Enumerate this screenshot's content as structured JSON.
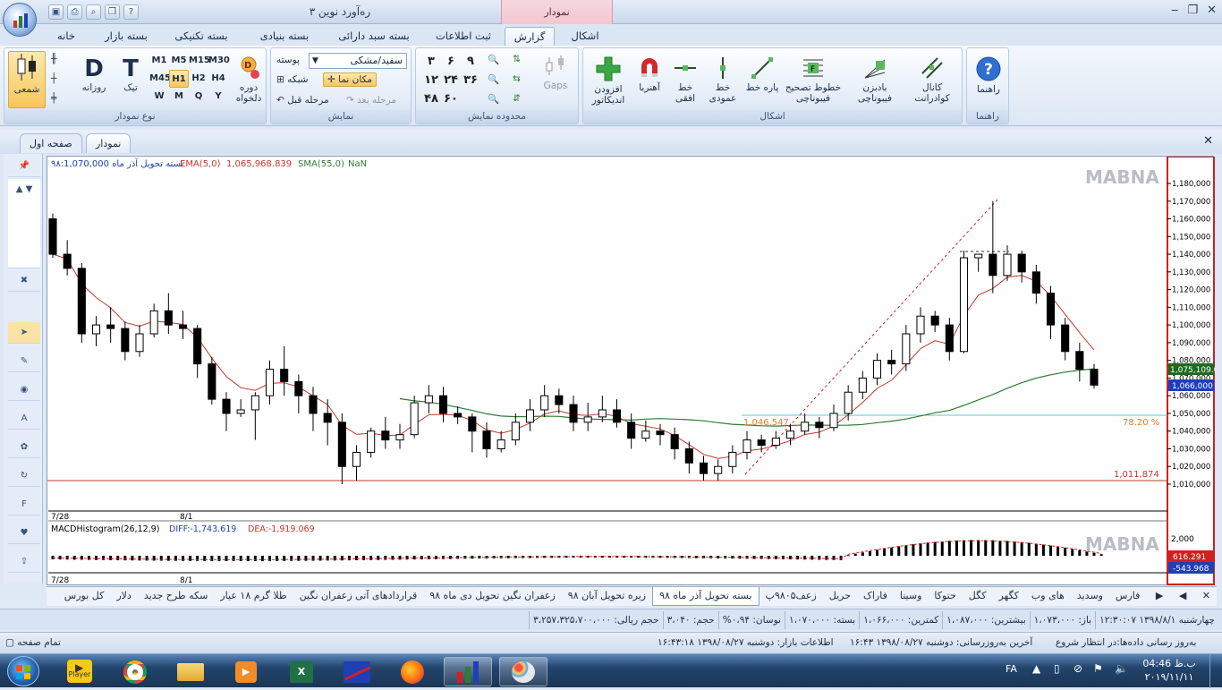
{
  "window": {
    "title": "ره‌آورد نوین ۳",
    "context_tab": "نمودار",
    "controls": [
      "minimize",
      "restore",
      "close"
    ]
  },
  "ribbon_tabs": [
    {
      "label": "خانه"
    },
    {
      "label": "بسته بازار"
    },
    {
      "label": "بسته تکنیکی"
    },
    {
      "label": "بسته بنیادی"
    },
    {
      "label": "بسته سبد دارائی"
    },
    {
      "label": "ثبت اطلاعات"
    },
    {
      "label": "گزارش",
      "active": true
    },
    {
      "label": "اشکال"
    }
  ],
  "ribbon": {
    "chart_type": {
      "label": "نوع نمودار",
      "candle": "شمعی",
      "daily": "روزانه",
      "tick": "تیک",
      "custom_period": "دوره دلخواه",
      "periods": [
        "M1",
        "M5",
        "M15",
        "M30",
        "M45",
        "H1",
        "H2",
        "H4",
        "W",
        "M",
        "Q",
        "Y"
      ],
      "d_letter": "D",
      "t_letter": "T"
    },
    "display": {
      "label": "نمایش",
      "bg_label": "پوسته",
      "bg_value": "سفید/مشکی",
      "grid": "شبکه",
      "cursor": "مکان نما",
      "undo": "مرحله قبل",
      "redo": "مرحله بعد"
    },
    "range": {
      "label": "محدوده نمایش",
      "nums": [
        "۳",
        "۶",
        "۹",
        "۱۲",
        "۲۴",
        "۳۶",
        "۴۸",
        "۶۰"
      ],
      "gaps": "Gaps"
    },
    "shapes": {
      "label": "اشکال",
      "items": [
        "کانال\nکوادرانت",
        "بادبزن\nفیبوناچی",
        "خطوط تصحیح\nفیبوناچی",
        "پاره خط",
        "خط\nعمودی",
        "خط\nافقی",
        "آهنربا",
        "افزودن\nاندیکاتور"
      ]
    },
    "help": {
      "label": "راهنما",
      "item": "راهنما"
    }
  },
  "doc_tabs": [
    {
      "label": "نمودار",
      "active": true
    },
    {
      "label": "صفحه اول"
    }
  ],
  "chart": {
    "header_name": "بسته تحویل آذر ماه ۹۸:1,070,000",
    "ema_label": "EMA(5,0)",
    "ema_value": "1,065,968.839",
    "sma_label": "SMA(55,0)",
    "sma_value": "NaN",
    "watermark": "MABNA",
    "price_ticks": [
      "1,180,000",
      "1,170,000",
      "1,160,000",
      "1,150,000",
      "1,140,000",
      "1,130,000",
      "1,120,000",
      "1,110,000",
      "1,100,000",
      "1,090,000",
      "1,080,000",
      "1,070,000",
      "1,060,000",
      "1,050,000",
      "1,040,000",
      "1,030,000",
      "1,020,000",
      "1,010,000"
    ],
    "last_price": "1,075,109.0",
    "current_price": "1,066,000",
    "fib_level": "1,046,547",
    "fib_pct": "78.20 %",
    "support": "1,011,874",
    "dates": [
      "7/28",
      "8/1"
    ],
    "macd": {
      "label": "MACDHistogram(26,12,9)",
      "diff": "DIFF:-1,743.619",
      "dea": "DEA:-1,919.069",
      "tick": "2,000",
      "v1": "616.291",
      "v2": "-543.968"
    },
    "colors": {
      "up": "#ffffff",
      "down": "#000000",
      "ema": "#c0392b",
      "sma": "#2e7d32",
      "last": "#1e6b1e",
      "current": "#1f3fb5",
      "fib": "#58c7d6",
      "support": "#c0392b",
      "watermark": "#b9bec6"
    }
  },
  "sheet_tabs": [
    "فارس",
    "وسدید",
    "های وب",
    "کگهر",
    "کگل",
    "حتوکا",
    "وسینا",
    "فاراک",
    "حریل",
    "زعف۹۸۰۵پ",
    "بسته تحویل آذر ماه ۹۸",
    "زیره تحویل آبان ۹۸",
    "زعفران نگین تحویل دی ماه ۹۸",
    "قراردادهای آتی زعفران نگین",
    "طلا گرم ۱۸ عیار",
    "سکه طرح جدید",
    "دلار",
    "کل بورس"
  ],
  "active_sheet": "بسته تحویل آذر ماه ۹۸",
  "info_bar": [
    "چهارشنبه ۱۳۹۸/۸/۱ ۱۲:۳۰:۰۷",
    "باز: ۱،۰۷۳،۰۰۰",
    "بیشترین: ۱،۰۸۷،۰۰۰",
    "کمترین: ۱،۰۶۶،۰۰۰",
    "بسته: ۱،۰۷۰،۰۰۰",
    "نوسان: ۰،۹۴%",
    "حجم: ۳،۰۴۰",
    "حجم ریالی: ۳،۲۵۷،۳۲۵،۷۰۰،۰۰۰"
  ],
  "status": {
    "left": "تمام صفحه",
    "center": "اطلاعات بازار: دوشنبه ۱۳۹۸/۰۸/۲۷ ۱۶:۴۳:۱۸",
    "center2": "آخرین به‌روزرسانی: دوشنبه ۱۳۹۸/۰۸/۲۷ ۱۶:۴۳",
    "right": "به‌روز رسانی داده‌ها:در انتظار شروع"
  },
  "taskbar": {
    "time": "04:46",
    "ampm": "ب.ظ",
    "date": "۲۰۱۹/۱۱/۱۱",
    "lang": "FA",
    "player": "Player"
  },
  "candles": [
    [
      1160,
      1140,
      1163,
      1138
    ],
    [
      1140,
      1132,
      1148,
      1128
    ],
    [
      1132,
      1095,
      1135,
      1090
    ],
    [
      1095,
      1100,
      1105,
      1088
    ],
    [
      1100,
      1098,
      1110,
      1090
    ],
    [
      1098,
      1085,
      1102,
      1080
    ],
    [
      1085,
      1095,
      1100,
      1082
    ],
    [
      1095,
      1108,
      1112,
      1093
    ],
    [
      1108,
      1100,
      1118,
      1095
    ],
    [
      1100,
      1098,
      1108,
      1092
    ],
    [
      1098,
      1078,
      1100,
      1070
    ],
    [
      1078,
      1058,
      1082,
      1055
    ],
    [
      1058,
      1050,
      1062,
      1040
    ],
    [
      1050,
      1052,
      1058,
      1048
    ],
    [
      1052,
      1060,
      1062,
      1035
    ],
    [
      1060,
      1075,
      1080,
      1055
    ],
    [
      1075,
      1068,
      1088,
      1060
    ],
    [
      1068,
      1060,
      1072,
      1050
    ],
    [
      1060,
      1050,
      1065,
      1040
    ],
    [
      1050,
      1045,
      1058,
      1032
    ],
    [
      1045,
      1020,
      1050,
      1010
    ],
    [
      1020,
      1028,
      1032,
      1012
    ],
    [
      1028,
      1040,
      1042,
      1025
    ],
    [
      1040,
      1035,
      1048,
      1030
    ],
    [
      1035,
      1038,
      1044,
      1030
    ],
    [
      1038,
      1056,
      1060,
      1036
    ],
    [
      1056,
      1060,
      1066,
      1050
    ],
    [
      1060,
      1050,
      1065,
      1045
    ],
    [
      1050,
      1048,
      1054,
      1044
    ],
    [
      1048,
      1040,
      1050,
      1028
    ],
    [
      1040,
      1030,
      1045,
      1025
    ],
    [
      1030,
      1035,
      1040,
      1028
    ],
    [
      1035,
      1045,
      1050,
      1032
    ],
    [
      1045,
      1052,
      1058,
      1040
    ],
    [
      1052,
      1060,
      1066,
      1048
    ],
    [
      1060,
      1055,
      1064,
      1050
    ],
    [
      1055,
      1045,
      1060,
      1040
    ],
    [
      1045,
      1048,
      1056,
      1040
    ],
    [
      1048,
      1052,
      1060,
      1045
    ],
    [
      1052,
      1045,
      1058,
      1042
    ],
    [
      1045,
      1036,
      1050,
      1030
    ],
    [
      1036,
      1040,
      1046,
      1034
    ],
    [
      1040,
      1038,
      1044,
      1032
    ],
    [
      1038,
      1030,
      1042,
      1024
    ],
    [
      1030,
      1022,
      1034,
      1016
    ],
    [
      1022,
      1016,
      1026,
      1012
    ],
    [
      1016,
      1020,
      1024,
      1012
    ],
    [
      1020,
      1028,
      1032,
      1016
    ],
    [
      1028,
      1035,
      1040,
      1024
    ],
    [
      1035,
      1032,
      1038,
      1028
    ],
    [
      1032,
      1036,
      1040,
      1030
    ],
    [
      1036,
      1040,
      1044,
      1032
    ],
    [
      1040,
      1045,
      1050,
      1038
    ],
    [
      1045,
      1042,
      1048,
      1036
    ],
    [
      1042,
      1050,
      1055,
      1040
    ],
    [
      1050,
      1062,
      1066,
      1046
    ],
    [
      1062,
      1070,
      1074,
      1058
    ],
    [
      1070,
      1080,
      1084,
      1066
    ],
    [
      1080,
      1078,
      1086,
      1072
    ],
    [
      1078,
      1095,
      1100,
      1074
    ],
    [
      1095,
      1105,
      1110,
      1090
    ],
    [
      1105,
      1100,
      1108,
      1096
    ],
    [
      1100,
      1085,
      1104,
      1080
    ],
    [
      1085,
      1138,
      1142,
      1084
    ],
    [
      1138,
      1140,
      1140,
      1130
    ],
    [
      1140,
      1128,
      1170,
      1118
    ],
    [
      1128,
      1140,
      1145,
      1125
    ],
    [
      1140,
      1130,
      1142,
      1124
    ],
    [
      1130,
      1118,
      1134,
      1112
    ],
    [
      1118,
      1100,
      1122,
      1092
    ],
    [
      1100,
      1085,
      1104,
      1080
    ],
    [
      1085,
      1075,
      1090,
      1068
    ],
    [
      1075,
      1066,
      1078,
      1064
    ]
  ]
}
